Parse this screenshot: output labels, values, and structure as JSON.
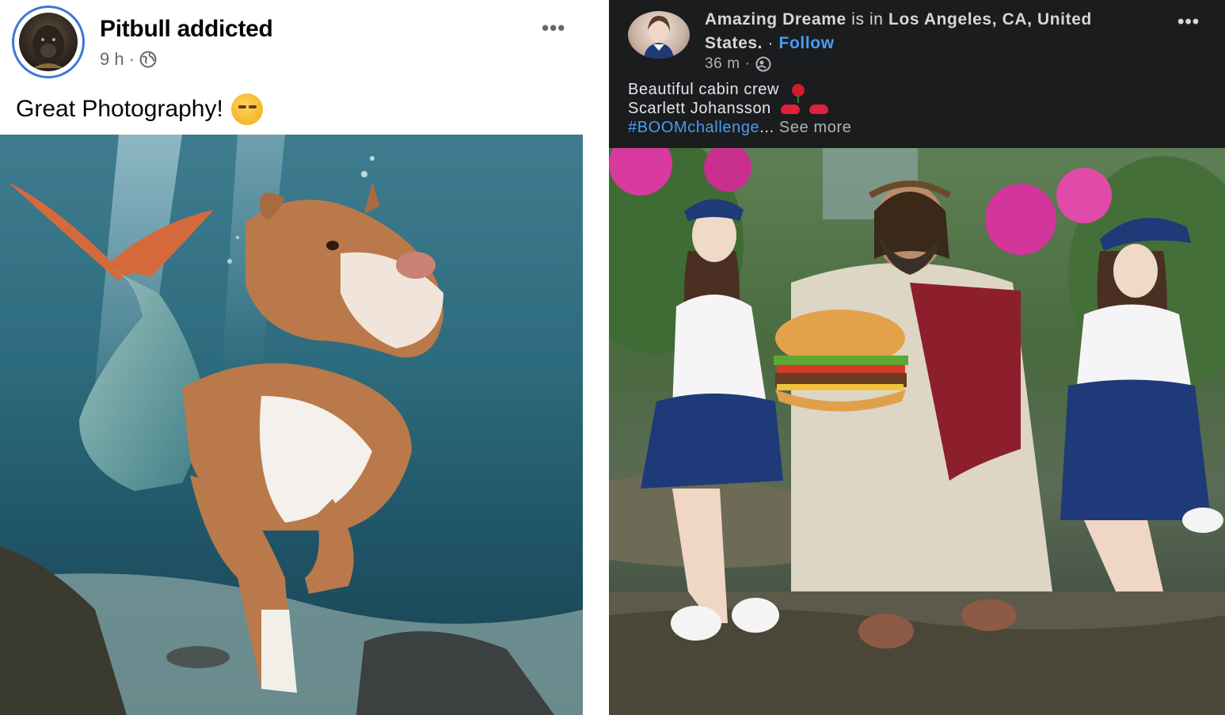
{
  "left_post": {
    "author": "Pitbull addicted",
    "time": "9 h",
    "separator": "·",
    "more_label": "•••",
    "caption": "Great Photography!",
    "caption_emoji": "smiling-face-with-hearts-icon",
    "audience_icon": "globe-icon"
  },
  "right_post": {
    "author": "Amazing Dreame",
    "is_in": "is in",
    "location": "Los Angeles, CA, United States.",
    "separator": "·",
    "follow_label": "Follow",
    "time": "36 m",
    "more_label": "•••",
    "caption_line1": "Beautiful cabin crew",
    "caption_line2": "Scarlett Johansson",
    "hashtag": "#BOOMchallenge",
    "ellipsis": "...",
    "see_more": "See more",
    "audience_icon": "friends-icon"
  },
  "colors": {
    "link_blue": "#4a9cf0",
    "avatar_ring": "#3b78d8",
    "dark_bg": "#1b1c1e"
  }
}
